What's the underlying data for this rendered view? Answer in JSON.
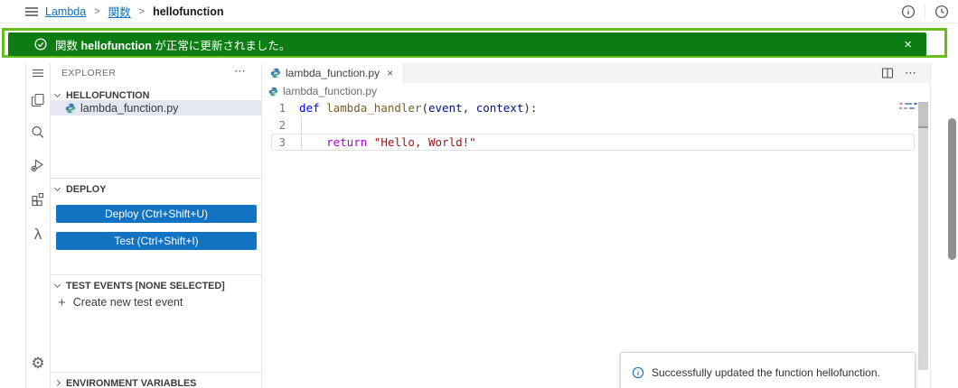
{
  "colors": {
    "success": "#0b7d12",
    "highlight": "#6abd1f",
    "accent": "#1273c2",
    "link": "#0a72bb"
  },
  "topnav": {
    "breadcrumb": {
      "separator": ">",
      "items": [
        {
          "label": "Lambda"
        },
        {
          "label": "関数"
        },
        {
          "label": "hellofunction"
        }
      ]
    }
  },
  "flashbar": {
    "message_prefix": "関数 ",
    "function_name": "hellofunction",
    "message_suffix": " が正常に更新されました。",
    "close_label": "×"
  },
  "sidebar": {
    "title": "EXPLORER",
    "more_label": "⋯",
    "folder": {
      "label": "HELLOFUNCTION",
      "file": "lambda_function.py"
    },
    "deploy": {
      "label": "DEPLOY",
      "deploy_button": "Deploy (Ctrl+Shift+U)",
      "test_button": "Test (Ctrl+Shift+I)"
    },
    "test_events": {
      "label": "TEST EVENTS [NONE SELECTED]",
      "plus": "+",
      "create_label": "Create new test event"
    },
    "environment": {
      "label": "ENVIRONMENT VARIABLES"
    }
  },
  "editor": {
    "tab_label": "lambda_function.py",
    "tab_close": "×",
    "more_label": "⋯",
    "breadcrumb": "lambda_function.py",
    "gutter": [
      "1",
      "2",
      "3"
    ],
    "code": {
      "l1": {
        "kw": "def",
        "fn": " lambda_handler",
        "p1": "(",
        "a1": "event",
        "sep": ", ",
        "a2": "context",
        "p2": "):"
      },
      "l3": {
        "indent": "    ",
        "kw": "return",
        "str": " \"Hello, World!\""
      }
    }
  },
  "toast": {
    "message": "Successfully updated the function hellofunction."
  }
}
